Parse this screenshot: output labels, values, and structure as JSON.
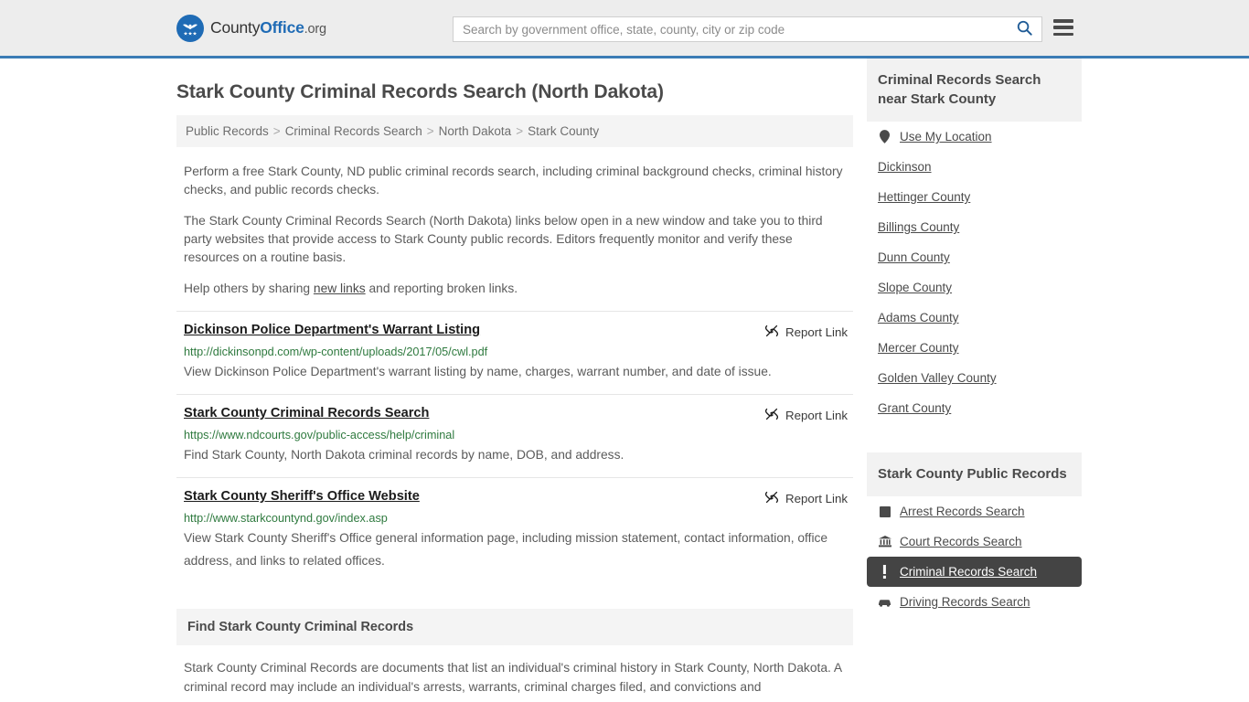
{
  "header": {
    "logo": {
      "part1": "County",
      "part2": "Office",
      "part3": ".org",
      "icon": "eagle-stars-seal-icon"
    },
    "search": {
      "placeholder": "Search by government office, state, county, city or zip code",
      "value": "",
      "search_icon": "search-icon"
    },
    "menu_icon": "hamburger-menu-icon",
    "brand_color": "#1f6bb5",
    "accent_border": "#3b7cb5"
  },
  "page": {
    "title": "Stark County Criminal Records Search (North Dakota)"
  },
  "breadcrumb": {
    "items": [
      {
        "label": "Public Records"
      },
      {
        "label": "Criminal Records Search"
      },
      {
        "label": "North Dakota"
      },
      {
        "label": "Stark County"
      }
    ],
    "separator": ">"
  },
  "intro": {
    "p1": "Perform a free Stark County, ND public criminal records search, including criminal background checks, criminal history checks, and public records checks.",
    "p2": "The Stark County Criminal Records Search (North Dakota) links below open in a new window and take you to third party websites that provide access to Stark County public records. Editors frequently monitor and verify these resources on a routine basis.",
    "p3_before": "Help others by sharing ",
    "p3_link": "new links",
    "p3_after": " and reporting broken links."
  },
  "results": {
    "report_label": "Report Link",
    "report_icon": "broken-link-icon",
    "items": [
      {
        "title": "Dickinson Police Department's Warrant Listing",
        "url": "http://dickinsonpd.com/wp-content/uploads/2017/05/cwl.pdf",
        "description": "View Dickinson Police Department's warrant listing by name, charges, warrant number, and date of issue."
      },
      {
        "title": "Stark County Criminal Records Search",
        "url": "https://www.ndcourts.gov/public-access/help/criminal",
        "description": "Find Stark County, North Dakota criminal records by name, DOB, and address."
      },
      {
        "title": "Stark County Sheriff's Office Website",
        "url": "http://www.starkcountynd.gov/index.asp",
        "description": "View Stark County Sheriff's Office general information page, including mission statement, contact information, office address, and links to related offices."
      }
    ]
  },
  "find_section": {
    "heading": "Find Stark County Criminal Records",
    "body": "Stark County Criminal Records are documents that list an individual's criminal history in Stark County, North Dakota. A criminal record may include an individual's arrests, warrants, criminal charges filed, and convictions and"
  },
  "sidebar": {
    "near_box": {
      "heading": "Criminal Records Search near Stark County",
      "items": [
        {
          "label": "Use My Location",
          "icon": "map-pin-icon"
        },
        {
          "label": "Dickinson",
          "icon": ""
        },
        {
          "label": "Hettinger County",
          "icon": ""
        },
        {
          "label": "Billings County",
          "icon": ""
        },
        {
          "label": "Dunn County",
          "icon": ""
        },
        {
          "label": "Slope County",
          "icon": ""
        },
        {
          "label": "Adams County",
          "icon": ""
        },
        {
          "label": "Mercer County",
          "icon": ""
        },
        {
          "label": "Golden Valley County",
          "icon": ""
        },
        {
          "label": "Grant County",
          "icon": ""
        }
      ]
    },
    "public_records_box": {
      "heading": "Stark County Public Records",
      "active_item": "Criminal Records Search",
      "active_bg": "#444444",
      "items": [
        {
          "label": "Arrest Records Search",
          "icon": "fingerprint-square-icon",
          "active": false
        },
        {
          "label": "Court Records Search",
          "icon": "courthouse-icon",
          "active": false
        },
        {
          "label": "Criminal Records Search",
          "icon": "exclamation-icon",
          "active": true
        },
        {
          "label": "Driving Records Search",
          "icon": "car-icon",
          "active": false
        }
      ]
    }
  }
}
